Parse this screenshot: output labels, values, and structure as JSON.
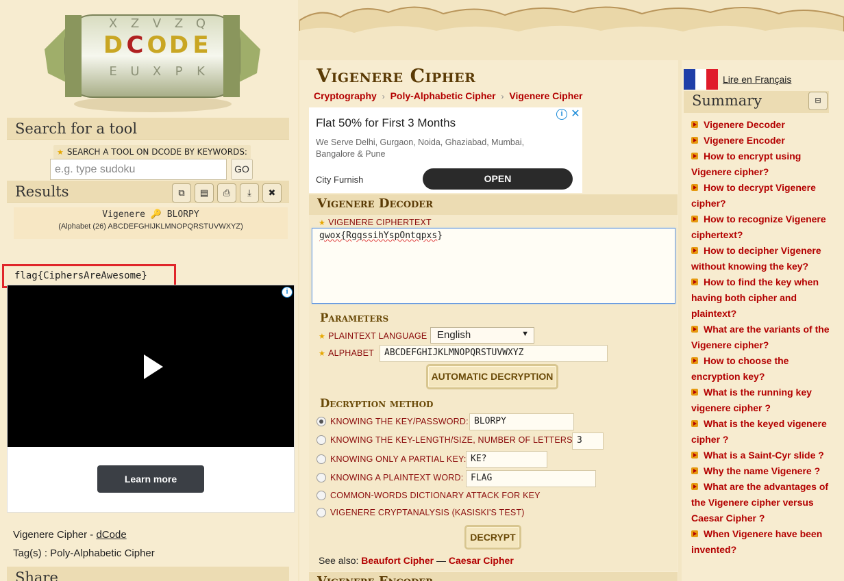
{
  "left": {
    "logo_text": "DCODE",
    "search": {
      "heading": "Search for a tool",
      "label": "SEARCH A TOOL ON DCODE BY KEYWORDS:",
      "placeholder": "e.g. type sudoku",
      "go_label": "GO"
    },
    "results": {
      "heading": "Results",
      "tools": [
        "copy-icon",
        "history-icon",
        "print-icon",
        "download-icon",
        "close-icon"
      ],
      "line1": "Vigenere 🔑 BLORPY",
      "line2": "(Alphabet (26) ABCDEFGHIJKLMNOPQRSTUVWXYZ)",
      "flag": "flag{CiphersAreAwesome}"
    },
    "video_ad": {
      "learn_more": "Learn more"
    },
    "credit_prefix": "Vigenere Cipher - ",
    "credit_link": "dCode",
    "tags": "Tag(s) : Poly-Alphabetic Cipher",
    "share_heading": "Share"
  },
  "main": {
    "title": "Vigenere Cipher",
    "breadcrumb": [
      "Cryptography",
      "Poly-Alphabetic Cipher",
      "Vigenere Cipher"
    ],
    "ad": {
      "title": "Flat 50% for First 3 Months",
      "desc": "We Serve Delhi, Gurgaon, Noida, Ghaziabad, Mumbai, Bangalore & Pune",
      "brand": "City Furnish",
      "cta": "OPEN"
    },
    "decoder": {
      "heading": "Vigenere Decoder",
      "ciphertext_label": "VIGENERE CIPHERTEXT",
      "ciphertext_prefix": "gwox{",
      "ciphertext_word": "RgqssihYspOntqpxs",
      "ciphertext_suffix": "}",
      "params_heading": "Parameters",
      "lang_label": "PLAINTEXT LANGUAGE",
      "lang_value": "English",
      "alphabet_label": "ALPHABET",
      "alphabet_value": "ABCDEFGHIJKLMNOPQRSTUVWXYZ",
      "auto_button": "AUTOMATIC DECRYPTION",
      "method_heading": "Decryption method",
      "methods": [
        {
          "label": "KNOWING THE KEY/PASSWORD:",
          "value": "BLORPY",
          "selected": true
        },
        {
          "label": "KNOWING THE KEY-LENGTH/SIZE, NUMBER OF LETTERS:",
          "value": "3",
          "selected": false
        },
        {
          "label": "KNOWING ONLY A PARTIAL KEY:",
          "value": "KE?",
          "selected": false
        },
        {
          "label": "KNOWING A PLAINTEXT WORD:",
          "value": "FLAG",
          "selected": false
        },
        {
          "label": "COMMON-WORDS DICTIONARY ATTACK FOR KEY",
          "value": null,
          "selected": false
        },
        {
          "label": "VIGENERE CRYPTANALYSIS (KASISKI'S TEST)",
          "value": null,
          "selected": false
        }
      ],
      "decrypt_button": "DECRYPT",
      "see_also_label": "See also: ",
      "see_also_1": "Beaufort Cipher",
      "see_also_sep": " — ",
      "see_also_2": "Caesar Cipher"
    },
    "encoder_heading": "Vigenere Encoder"
  },
  "right": {
    "lang_link": "Lire en Français",
    "summary_heading": "Summary",
    "summary_toggle": "⊟",
    "items": [
      "Vigenere Decoder",
      "Vigenere Encoder",
      "How to encrypt using Vigenere cipher?",
      "How to decrypt Vigenere cipher?",
      "How to recognize Vigenere ciphertext?",
      "How to decipher Vigenere without knowing the key?",
      "How to find the key when having both cipher and plaintext?",
      "What are the variants of the Vigenere cipher?",
      "How to choose the encryption key?",
      "What is the running key vigenere cipher ?",
      "What is the keyed vigenere cipher ?",
      "What is a Saint-Cyr slide ?",
      "Why the name Vigenere ?",
      "What are the advantages of the Vigenere cipher versus Caesar Cipher ?",
      "When Vigenere have been invented?"
    ]
  },
  "colors": {
    "background": "#f3e6c4",
    "accent_red": "#b30000",
    "heading_brown": "#5a3a05",
    "highlight_box": "#e0262a"
  }
}
